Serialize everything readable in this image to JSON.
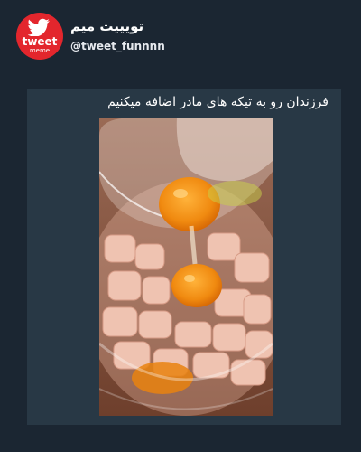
{
  "account": {
    "avatar_text_top": "tweet",
    "avatar_text_bottom": "meme",
    "display_name": "تویییت میم",
    "handle": "@tweet_funnnn",
    "brand_color": "#e3262d"
  },
  "post": {
    "caption": "فرزندان رو به تیکه های مادر اضافه میکنیم",
    "image_description_icon": "video-frame"
  },
  "colors": {
    "background": "#1b2632",
    "card": "#283845",
    "text": "#ffffff"
  }
}
